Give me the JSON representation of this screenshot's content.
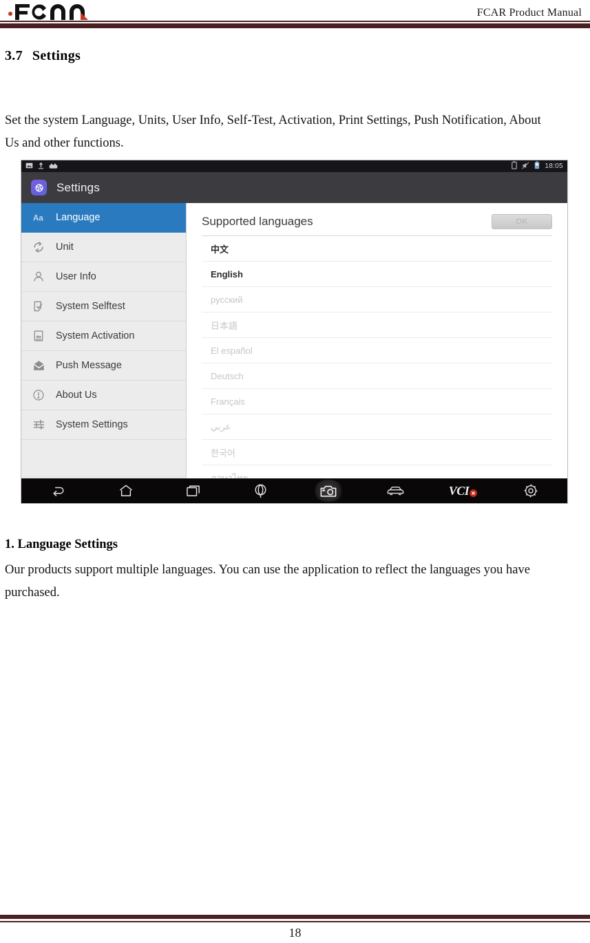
{
  "document": {
    "header_title": "FCAR Product Manual",
    "logo_text": "FCAR",
    "page_number": "18",
    "section_number": "3.7",
    "section_title": "Settings",
    "intro_paragraph": "Set the system Language, Units, User Info, Self-Test, Activation, Print Settings, Push Notification, About Us and other functions.",
    "subheading": "1. Language Settings",
    "body_paragraph": "Our products support multiple languages. You can use the application to reflect the languages you have purchased."
  },
  "colors": {
    "rule": "#4a1f22",
    "accent_blue": "#2a7ac0",
    "logo_red": "#c0392b",
    "vci_badge_red": "#c42a17"
  },
  "figure": {
    "statusbar": {
      "left_icons": [
        "image-icon",
        "upload-icon",
        "usb-adapter-icon"
      ],
      "right_icons": [
        "battery-outline-icon",
        "mute-icon",
        "battery-icon"
      ],
      "time": "18:05"
    },
    "appbar": {
      "icon": "gear-icon",
      "title": "Settings"
    },
    "sidebar": {
      "items": [
        {
          "label": "Language",
          "icon": "font-size-icon",
          "active": true
        },
        {
          "label": "Unit",
          "icon": "convert-icon",
          "active": false
        },
        {
          "label": "User Info",
          "icon": "person-icon",
          "active": false
        },
        {
          "label": "System Selftest",
          "icon": "document-check-icon",
          "active": false
        },
        {
          "label": "System Activation",
          "icon": "picture-icon",
          "active": false
        },
        {
          "label": "Push Message",
          "icon": "envelope-icon",
          "active": false
        },
        {
          "label": "About Us",
          "icon": "info-circle-icon",
          "active": false
        },
        {
          "label": "System Settings",
          "icon": "sliders-icon",
          "active": false
        }
      ]
    },
    "panel": {
      "title": "Supported languages",
      "ok_label": "OK",
      "languages": [
        {
          "label": "中文",
          "state": "strong"
        },
        {
          "label": "English",
          "state": "strong"
        },
        {
          "label": "русский",
          "state": "faded"
        },
        {
          "label": "日本語",
          "state": "faded"
        },
        {
          "label": "El español",
          "state": "faded"
        },
        {
          "label": "Deutsch",
          "state": "faded"
        },
        {
          "label": "Français",
          "state": "faded"
        },
        {
          "label": "عربي",
          "state": "faded"
        },
        {
          "label": "한국어",
          "state": "faded"
        },
        {
          "label": "ภาษาไทย",
          "state": "faded"
        }
      ]
    },
    "navbar": {
      "buttons": [
        {
          "icon": "back-icon",
          "highlight": false,
          "label": ""
        },
        {
          "icon": "home-icon",
          "highlight": false,
          "label": ""
        },
        {
          "icon": "recents-icon",
          "highlight": false,
          "label": ""
        },
        {
          "icon": "browser-icon",
          "highlight": false,
          "label": ""
        },
        {
          "icon": "camera-icon",
          "highlight": true,
          "label": ""
        },
        {
          "icon": "car-icon",
          "highlight": false,
          "label": ""
        },
        {
          "icon": "vci-icon",
          "highlight": false,
          "label": "VCI"
        },
        {
          "icon": "settings-gear-icon",
          "highlight": false,
          "label": ""
        }
      ]
    }
  }
}
